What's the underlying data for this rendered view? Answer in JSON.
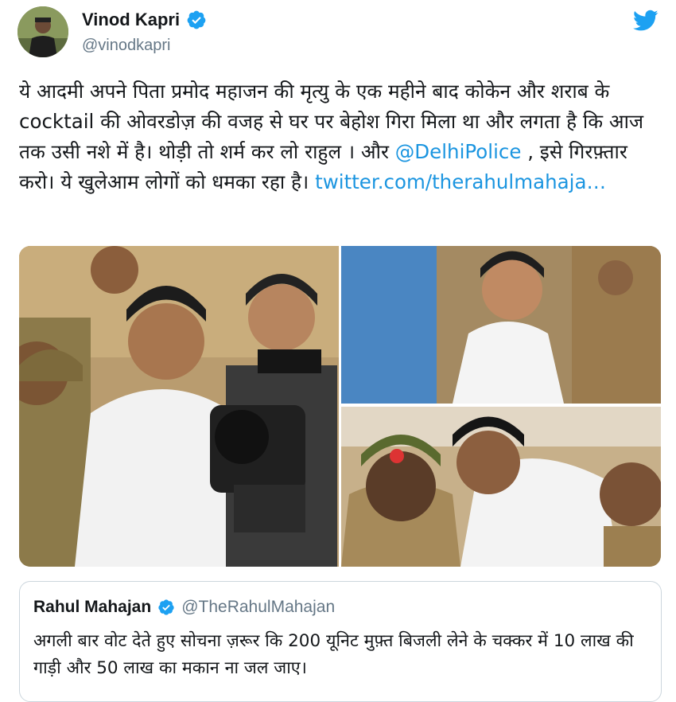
{
  "author": {
    "name": "Vinod Kapri",
    "handle": "@vinodkapri"
  },
  "tweet": {
    "text_part1": "ये आदमी अपने पिता प्रमोद महाजन की मृत्यु के एक महीने बाद कोकेन और शराब के cocktail की ओवरडोज़ की वजह से घर पर बेहोश गिरा मिला था और लगता है कि आज तक उसी नशे में है। थोड़ी तो शर्म कर लो राहुल । और ",
    "mention": "@DelhiPolice",
    "text_part2": " , इसे गिरफ़्तार करो। ये खुलेआम लोगों को धमका रहा है। ",
    "link": "twitter.com/therahulmahaja…"
  },
  "quoted": {
    "name": "Rahul Mahajan",
    "handle": "@TheRahulMahajan",
    "text": "अगली बार वोट देते हुए सोचना ज़रूर कि 200 यूनिट मुफ़्त बिजली लेने के चक्कर में 10 लाख की गाड़ी और 50 लाख का मकान ना जल जाए।"
  },
  "icons": {
    "verified": "verified-badge-icon",
    "twitter": "twitter-bird-icon"
  },
  "colors": {
    "brand_blue": "#1da1f2",
    "link_blue": "#1b95e0",
    "muted": "#657786"
  }
}
